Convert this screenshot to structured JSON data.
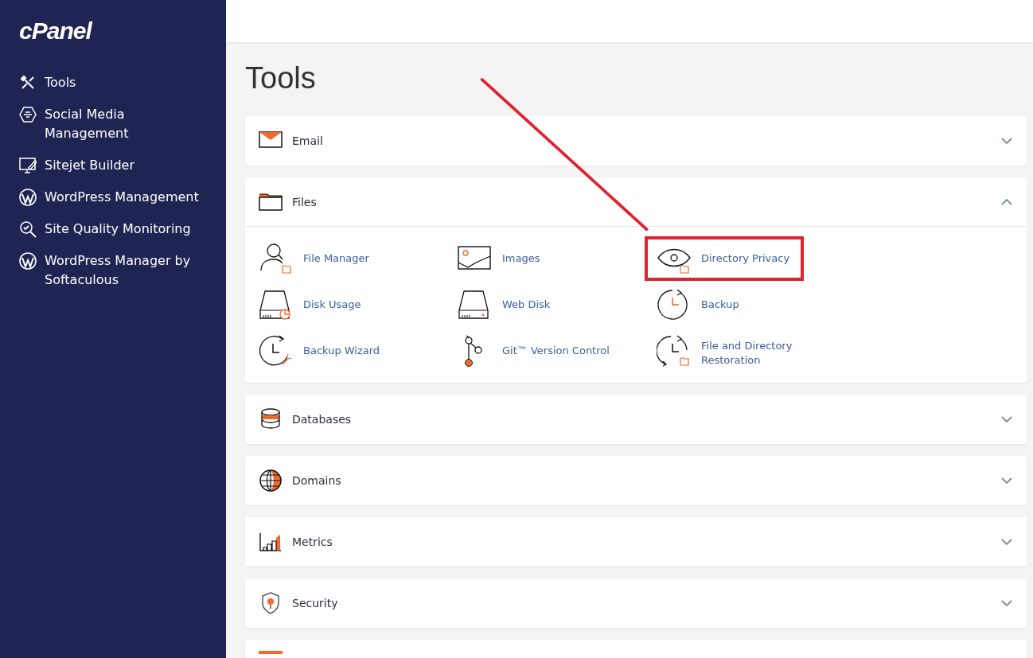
{
  "sidebar": {
    "logo": "cPanel",
    "items": [
      {
        "label": "Tools"
      },
      {
        "label": "Social Media Management"
      },
      {
        "label": "Sitejet Builder"
      },
      {
        "label": "WordPress Management"
      },
      {
        "label": "Site Quality Monitoring"
      },
      {
        "label": "WordPress Manager by Softaculous"
      }
    ]
  },
  "page_title": "Tools",
  "sections": [
    {
      "title": "Email",
      "expanded": false
    },
    {
      "title": "Files",
      "expanded": true,
      "items": [
        {
          "label": "File Manager",
          "highlighted": false
        },
        {
          "label": "Images",
          "highlighted": false
        },
        {
          "label": "Directory Privacy",
          "highlighted": true
        },
        {
          "label": "Disk Usage",
          "highlighted": false
        },
        {
          "label": "Web Disk",
          "highlighted": false
        },
        {
          "label": "Backup",
          "highlighted": false
        },
        {
          "label": "Backup Wizard",
          "highlighted": false
        },
        {
          "label": "Git™ Version Control",
          "highlighted": false
        },
        {
          "label": "File and Directory Restoration",
          "highlighted": false
        }
      ]
    },
    {
      "title": "Databases",
      "expanded": false
    },
    {
      "title": "Domains",
      "expanded": false
    },
    {
      "title": "Metrics",
      "expanded": false
    },
    {
      "title": "Security",
      "expanded": false
    }
  ]
}
